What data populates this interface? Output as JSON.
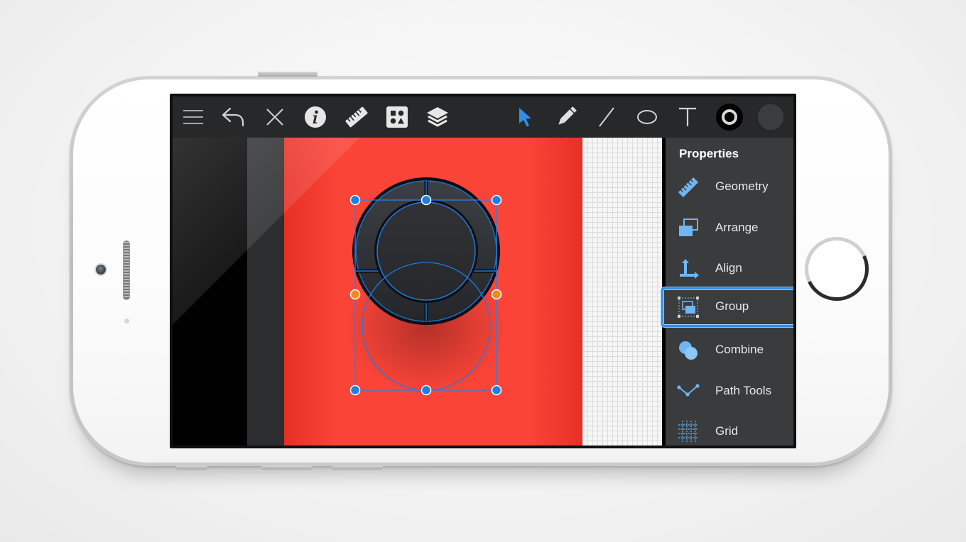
{
  "toolbar": {
    "left_tools": [
      "menu-icon",
      "undo-icon",
      "close-icon",
      "info-icon",
      "ruler-icon",
      "shapes-library-icon",
      "layers-icon"
    ],
    "right_tools": [
      "select-arrow-icon",
      "pencil-icon",
      "line-icon",
      "ellipse-icon",
      "text-icon",
      "stroke-color-well",
      "fill-color-well"
    ],
    "active_tool": "select-arrow-icon",
    "accent_color": "#2f8fe6"
  },
  "canvas": {
    "artboard_color": "#fb4438",
    "handle_color": "#1a7fe8",
    "side_handle_color": "#f08a1c"
  },
  "properties": {
    "title": "Properties",
    "items": [
      {
        "label": "Geometry",
        "icon": "ruler-icon"
      },
      {
        "label": "Arrange",
        "icon": "arrange-icon"
      },
      {
        "label": "Align",
        "icon": "align-icon"
      },
      {
        "label": "Group",
        "icon": "group-icon",
        "selected": true
      },
      {
        "label": "Combine",
        "icon": "combine-icon"
      },
      {
        "label": "Path Tools",
        "icon": "path-tools-icon"
      },
      {
        "label": "Grid",
        "icon": "grid-icon"
      }
    ]
  }
}
